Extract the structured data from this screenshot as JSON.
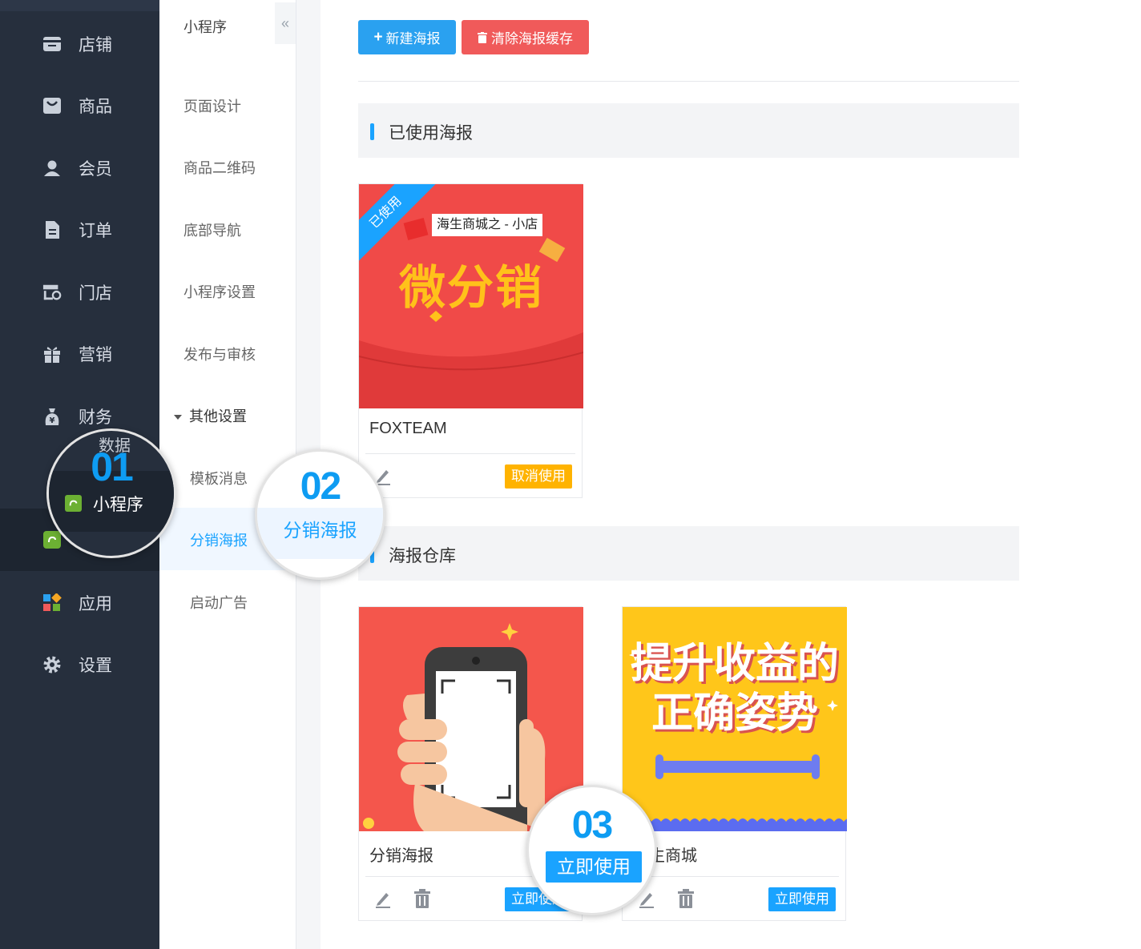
{
  "sidebar": {
    "items": [
      {
        "label": "店铺",
        "icon": "store-icon"
      },
      {
        "label": "商品",
        "icon": "goods-icon"
      },
      {
        "label": "会员",
        "icon": "member-icon"
      },
      {
        "label": "订单",
        "icon": "order-icon"
      },
      {
        "label": "门店",
        "icon": "shop-icon"
      },
      {
        "label": "营销",
        "icon": "gift-icon"
      },
      {
        "label": "财务",
        "icon": "finance-icon"
      },
      {
        "label": "应用",
        "icon": "apps-icon"
      },
      {
        "label": "设置",
        "icon": "gear-icon"
      }
    ]
  },
  "subnav": {
    "title": "小程序",
    "items": [
      "页面设计",
      "商品二维码",
      "底部导航",
      "小程序设置",
      "发布与审核"
    ],
    "group": "其他设置",
    "children": [
      "模板消息",
      "分销海报",
      "启动广告"
    ],
    "collapse_glyph": "«"
  },
  "toolbar": {
    "new_label": "新建海报",
    "clear_label": "清除海报缓存"
  },
  "sections": {
    "used": "已使用海报",
    "warehouse": "海报仓库"
  },
  "used_poster": {
    "ribbon": "已使用",
    "shop_tag": "海生商城之 - 小店",
    "headline": "微分销",
    "name": "FOXTEAM",
    "action": "取消使用"
  },
  "warehouse_posters": [
    {
      "name": "分销海报",
      "action": "立即使用"
    },
    {
      "name": "海生商城",
      "headline": "提升收益的 正确姿势",
      "action": "立即使用"
    }
  ],
  "callouts": {
    "c1": {
      "number": "01",
      "label": "小程序",
      "ghost": "数据"
    },
    "c2": {
      "number": "02",
      "label": "分销海报"
    },
    "c3": {
      "number": "03",
      "label": "立即使用"
    }
  },
  "colors": {
    "accent": "#1aa3ff",
    "danger": "#f05a5a",
    "warning": "#ffb300",
    "sidebar": "#262f3d"
  }
}
